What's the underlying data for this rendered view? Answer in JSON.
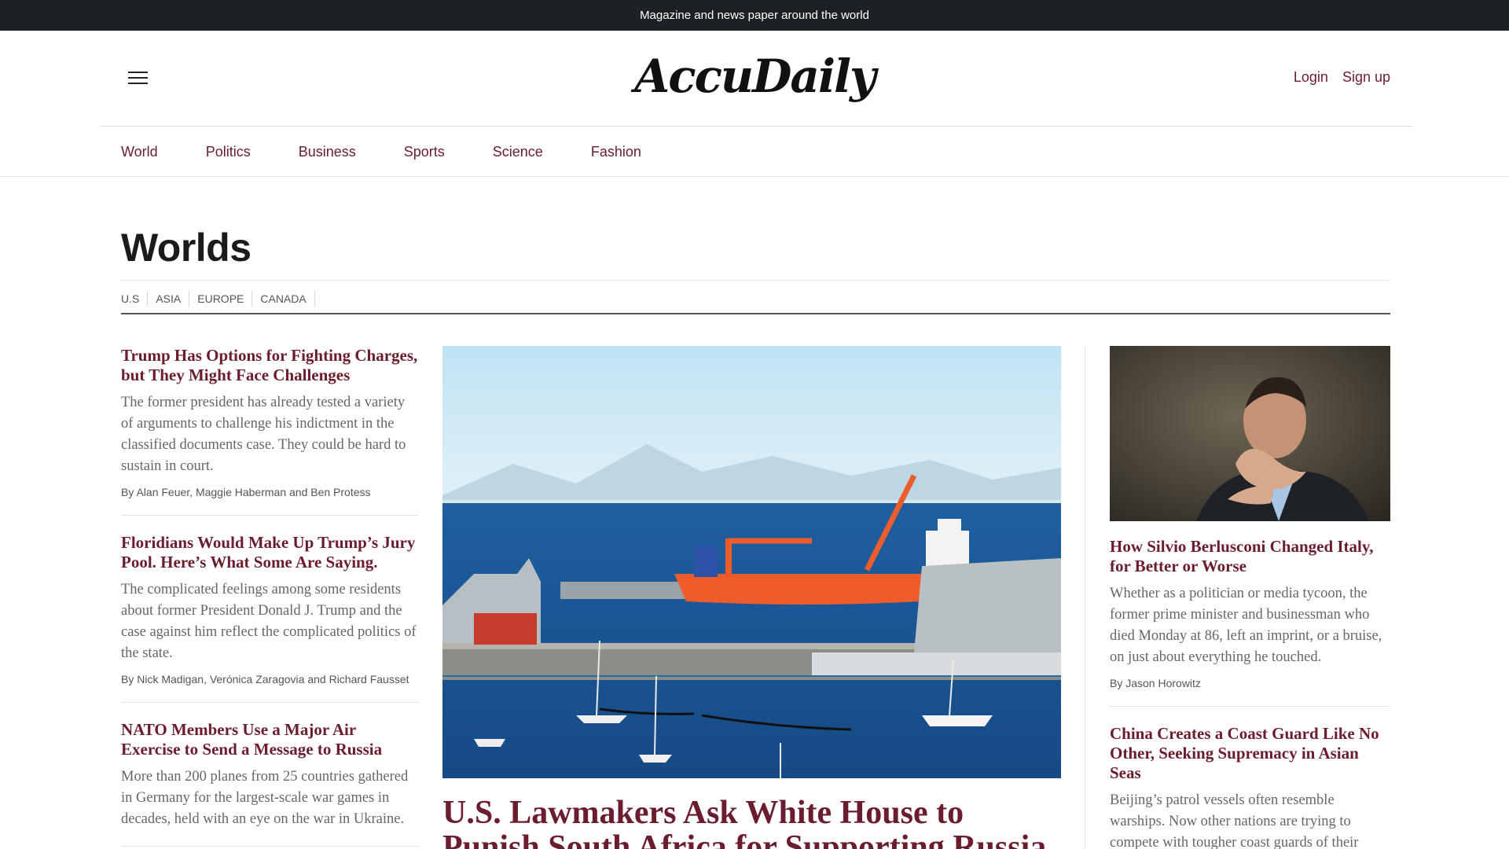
{
  "topbar": {
    "tagline": "Magazine and news paper around the world"
  },
  "header": {
    "logo": "AccuDaily",
    "login": "Login",
    "signup": "Sign up"
  },
  "nav": [
    "World",
    "Politics",
    "Business",
    "Sports",
    "Science",
    "Fashion"
  ],
  "section": {
    "title": "Worlds",
    "subnav": [
      "U.S",
      "ASIA",
      "EUROPE",
      "CANADA"
    ]
  },
  "left_articles": [
    {
      "headline": "Trump Has Options for Fighting Charges, but They Might Face Challenges",
      "summary": "The former president has already tested a variety of arguments to challenge his indictment in the classified documents case. They could be hard to sustain in court.",
      "byline": "By Alan Feuer, Maggie Haberman and Ben Protess"
    },
    {
      "headline": "Floridians Would Make Up Trump’s Jury Pool. Here’s What Some Are Saying.",
      "summary": "The complicated feelings among some residents about former President Donald J. Trump and the case against him reflect the complicated politics of the state.",
      "byline": "By Nick Madigan, Verónica Zaragovia and Richard Fausset"
    },
    {
      "headline": "NATO Members Use a Major Air Exercise to Send a Message to Russia",
      "summary": "More than 200 planes from 25 countries gathered in Germany for the largest-scale war games in decades, held with an eye on the war in Ukraine."
    }
  ],
  "main_article": {
    "headline": "U.S. Lawmakers Ask White House to Punish South Africa for Supporting Russia"
  },
  "right_articles": [
    {
      "headline": "How Silvio Berlusconi Changed Italy, for Better or Worse",
      "summary": "Whether as a politician or media tycoon, the former prime minister and businessman who died Monday at 86, left an imprint, or a bruise, on just about everything he touched.",
      "byline": "By Jason Horowitz"
    },
    {
      "headline": "China Creates a Coast Guard Like No Other, Seeking Supremacy in Asian Seas",
      "summary": "Beijing’s patrol vessels often resemble warships. Now other nations are trying to compete with tougher coast guards of their own."
    }
  ]
}
